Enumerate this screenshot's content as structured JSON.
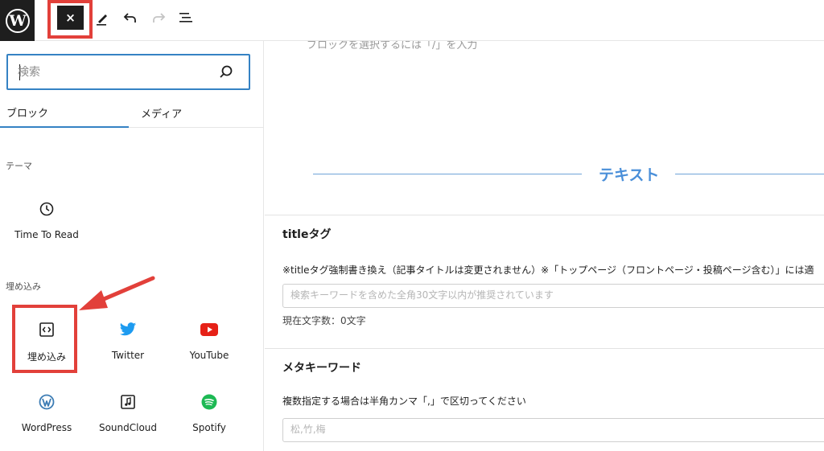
{
  "toolbar": {
    "close_glyph": "×"
  },
  "sidebar": {
    "search": {
      "placeholder": "検索",
      "value": ""
    },
    "tabs": [
      "ブロック",
      "メディア"
    ],
    "sections": [
      {
        "title": "テーマ",
        "items": [
          {
            "label": "Time To Read",
            "icon": "clock-icon"
          }
        ]
      },
      {
        "title": "埋め込み",
        "items": [
          {
            "label": "埋め込み",
            "icon": "embed-icon"
          },
          {
            "label": "Twitter",
            "icon": "twitter-icon"
          },
          {
            "label": "YouTube",
            "icon": "youtube-icon"
          },
          {
            "label": "WordPress",
            "icon": "wordpress-icon"
          },
          {
            "label": "SoundCloud",
            "icon": "soundcloud-icon"
          },
          {
            "label": "Spotify",
            "icon": "spotify-icon"
          }
        ]
      }
    ]
  },
  "main": {
    "block_placeholder": "ブロックを選択するには「/」を入力",
    "heading": "テキスト",
    "title_tag": {
      "title": "titleタグ",
      "description": "※titleタグ強制書き換え（記事タイトルは変更されません）※「トップページ（フロントページ・投稿ページ含む）」には適",
      "placeholder": "検索キーワードを含めた全角30文字以内が推奨されています",
      "char_count": "現在文字数：0文字"
    },
    "meta_keyword": {
      "title": "メタキーワード",
      "description": "複数指定する場合は半角カンマ「,」で区切ってください",
      "placeholder": "松,竹,梅"
    }
  },
  "colors": {
    "accent": "#3582c4",
    "heading_blue": "#4a8fd9",
    "annotation_red": "#e2403a",
    "twitter": "#1d9bf0",
    "youtube": "#e62117",
    "spotify": "#1db954",
    "wordpress": "#3c7cb4"
  }
}
